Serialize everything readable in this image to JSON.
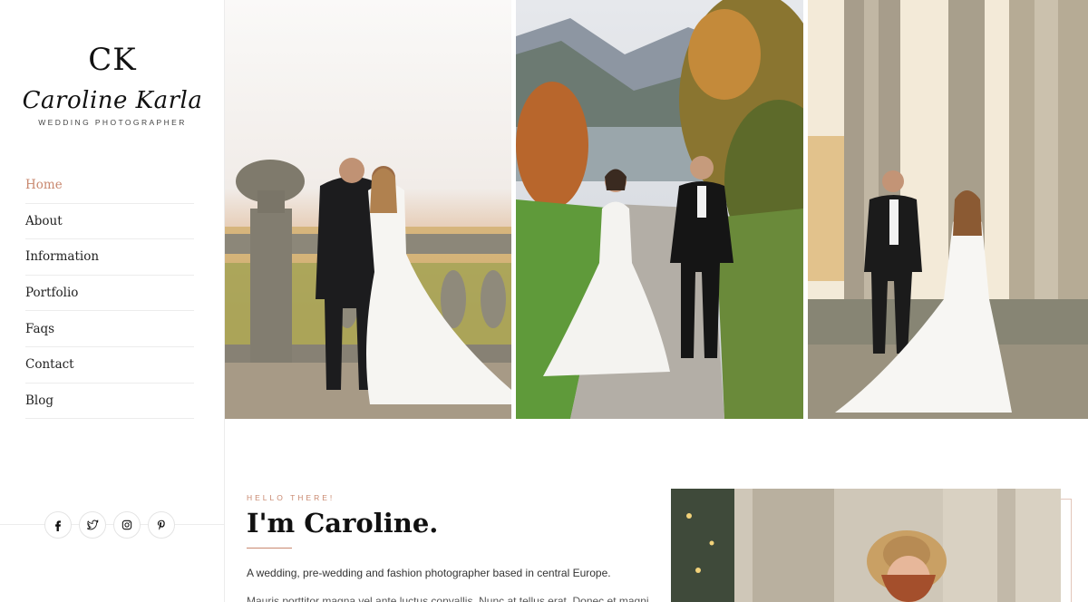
{
  "logo": {
    "monogram": "CK",
    "script_name": "Caroline Karla",
    "tagline": "WEDDING PHOTOGRAPHER"
  },
  "nav": {
    "items": [
      {
        "label": "Home",
        "active": true
      },
      {
        "label": "About",
        "active": false
      },
      {
        "label": "Information",
        "active": false
      },
      {
        "label": "Portfolio",
        "active": false
      },
      {
        "label": "Faqs",
        "active": false
      },
      {
        "label": "Contact",
        "active": false
      },
      {
        "label": "Blog",
        "active": false
      }
    ]
  },
  "social": {
    "icons": [
      "facebook-icon",
      "twitter-icon",
      "instagram-icon",
      "pinterest-icon"
    ]
  },
  "hero": {
    "photos": [
      "couple-at-balustrade-photo",
      "couple-walking-photo",
      "couple-by-columns-photo"
    ]
  },
  "about": {
    "eyebrow": "HELLO THERE!",
    "heading": "I'm Caroline.",
    "intro": "A wedding, pre-wedding and fashion photographer based in central Europe.",
    "body_partial": "Mauris porttitor magna vel ante luctus convallis. Nunc at tellus erat. Donec et magni"
  },
  "colors": {
    "accent": "#c9886f",
    "text": "#222222",
    "divider": "#ececec",
    "background": "#ffffff"
  }
}
